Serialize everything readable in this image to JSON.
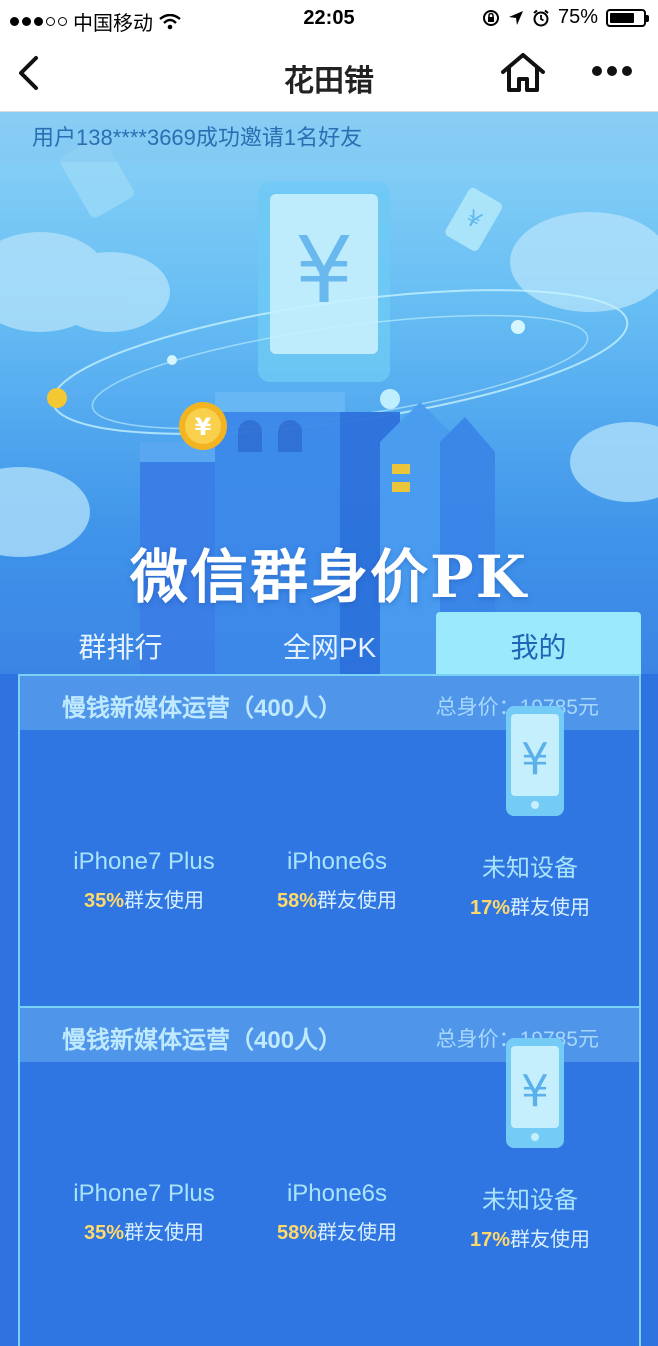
{
  "status_bar": {
    "carrier": "中国移动",
    "time": "22:05",
    "battery": "75%",
    "battery_level": 0.75
  },
  "nav": {
    "title": "花田错"
  },
  "hero": {
    "ticker": "用户138****3669成功邀请1名好友",
    "title": "微信群身价PK"
  },
  "tabs": [
    {
      "label": "群排行",
      "active": false
    },
    {
      "label": "全网PK",
      "active": false
    },
    {
      "label": "我的",
      "active": true
    }
  ],
  "cards": [
    {
      "group_name": "慢钱新媒体运营（400人）",
      "total_value": "总身价：19785元",
      "devices": [
        {
          "name": "iPhone7 Plus",
          "percent": "35%",
          "suffix": "群友使用"
        },
        {
          "name": "iPhone6s",
          "percent": "58%",
          "suffix": "群友使用"
        },
        {
          "name": "未知设备",
          "percent": "17%",
          "suffix": "群友使用"
        }
      ]
    },
    {
      "group_name": "慢钱新媒体运营（400人）",
      "total_value": "总身价：19785元",
      "devices": [
        {
          "name": "iPhone7 Plus",
          "percent": "35%",
          "suffix": "群友使用"
        },
        {
          "name": "iPhone6s",
          "percent": "58%",
          "suffix": "群友使用"
        },
        {
          "name": "未知设备",
          "percent": "17%",
          "suffix": "群友使用"
        }
      ]
    }
  ],
  "icons": {
    "back": "chevron-left-icon",
    "home": "home-icon",
    "more": "more-dots-icon",
    "device": "yuan-phone-icon",
    "coin": "yuan-coin-icon"
  },
  "colors": {
    "accent_percent": "#ffd96b",
    "active_tab": "#9ae9fd",
    "card_border": "#7bd2f7"
  }
}
